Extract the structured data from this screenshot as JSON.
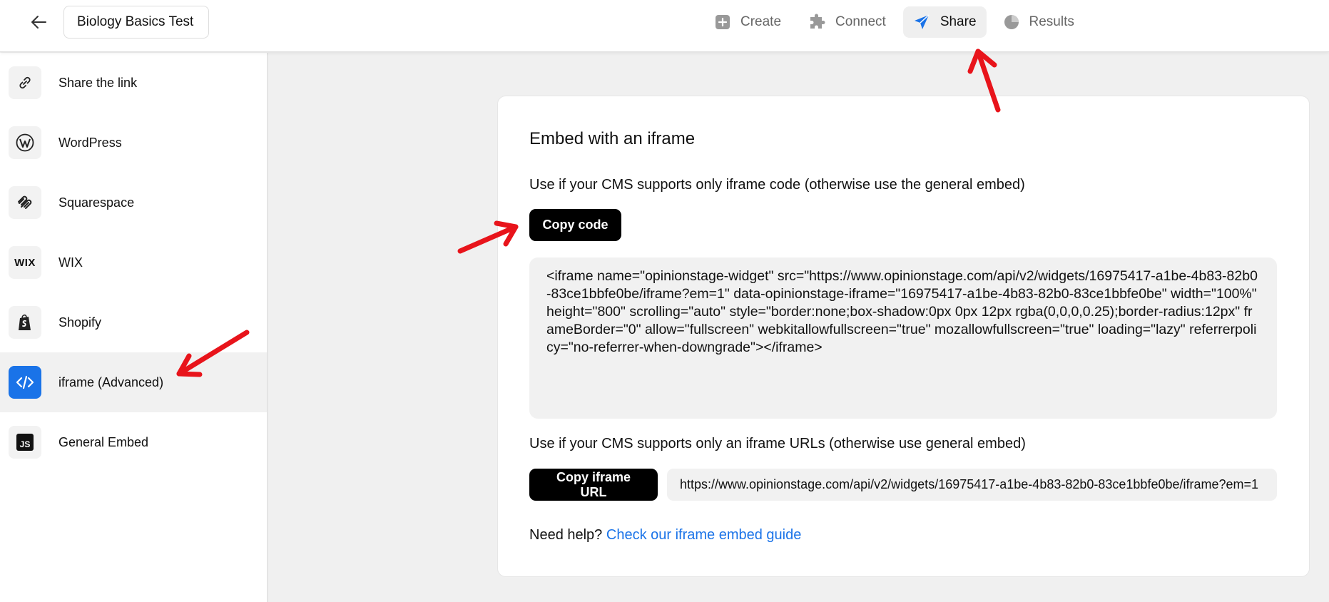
{
  "header": {
    "title": "Biology Basics Test",
    "nav": [
      {
        "label": "Create",
        "icon": "plus-square-icon"
      },
      {
        "label": "Connect",
        "icon": "puzzle-icon"
      },
      {
        "label": "Share",
        "icon": "paper-plane-icon"
      },
      {
        "label": "Results",
        "icon": "pie-chart-icon"
      }
    ],
    "active_nav": "Share"
  },
  "sidebar": {
    "items": [
      {
        "label": "Share the link",
        "icon": "link-icon"
      },
      {
        "label": "WordPress",
        "icon": "wordpress-icon"
      },
      {
        "label": "Squarespace",
        "icon": "squarespace-icon"
      },
      {
        "label": "WIX",
        "icon": "wix-icon"
      },
      {
        "label": "Shopify",
        "icon": "shopify-icon"
      },
      {
        "label": "iframe (Advanced)",
        "icon": "code-icon"
      },
      {
        "label": "General Embed",
        "icon": "js-icon"
      }
    ],
    "active": "iframe (Advanced)",
    "wix_logo_text": "WIX",
    "js_logo_text": "JS"
  },
  "main": {
    "heading": "Embed with an iframe",
    "desc1": "Use if your CMS supports only iframe code (otherwise use the general embed)",
    "copy_code_label": "Copy code",
    "code": "<iframe name=\"opinionstage-widget\" src=\"https://www.opinionstage.com/api/v2/widgets/16975417-a1be-4b83-82b0-83ce1bbfe0be/iframe?em=1\" data-opinionstage-iframe=\"16975417-a1be-4b83-82b0-83ce1bbfe0be\" width=\"100%\" height=\"800\" scrolling=\"auto\" style=\"border:none;box-shadow:0px 0px 12px rgba(0,0,0,0.25);border-radius:12px\" frameBorder=\"0\" allow=\"fullscreen\" webkitallowfullscreen=\"true\" mozallowfullscreen=\"true\" loading=\"lazy\" referrerpolicy=\"no-referrer-when-downgrade\"></iframe>",
    "desc2": "Use if your CMS supports only an iframe URLs (otherwise use general embed)",
    "copy_url_label": "Copy iframe URL",
    "iframe_url": "https://www.opinionstage.com/api/v2/widgets/16975417-a1be-4b83-82b0-83ce1bbfe0be/iframe?em=1",
    "help_prefix": "Need help?",
    "help_link": "Check our iframe embed guide"
  },
  "colors": {
    "accent": "#1a73e8",
    "annotation_arrow": "#e8141b",
    "button": "#000000"
  }
}
